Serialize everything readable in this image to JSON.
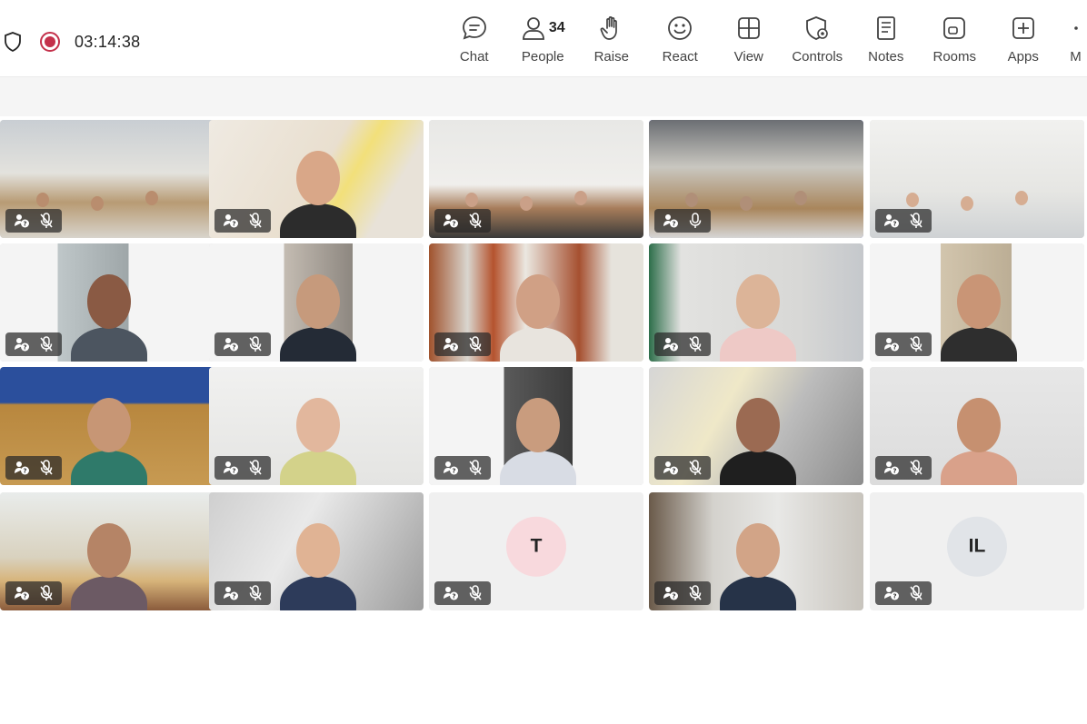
{
  "call": {
    "timer": "03:14:38"
  },
  "toolbar": {
    "items": [
      {
        "label": "Chat",
        "icon": "chat-icon"
      },
      {
        "label": "People",
        "icon": "people-icon",
        "count": "34"
      },
      {
        "label": "Raise",
        "icon": "hand-icon"
      },
      {
        "label": "React",
        "icon": "smiley-icon"
      },
      {
        "label": "View",
        "icon": "grid-icon"
      },
      {
        "label": "Controls",
        "icon": "shield-gear-icon"
      },
      {
        "label": "Notes",
        "icon": "notes-icon"
      },
      {
        "label": "Rooms",
        "icon": "rooms-icon"
      },
      {
        "label": "Apps",
        "icon": "plus-square-icon"
      },
      {
        "label": "M",
        "icon": "more-icon"
      }
    ]
  },
  "participants": [
    {
      "kind": "video",
      "scene": "meeting-room",
      "muted": true
    },
    {
      "kind": "video",
      "scene": "woman-glasses-blurred",
      "muted": true
    },
    {
      "kind": "video",
      "scene": "office-flags",
      "muted": true
    },
    {
      "kind": "video",
      "scene": "conference-hall",
      "muted": false,
      "active": true
    },
    {
      "kind": "video",
      "scene": "group-standing",
      "muted": true
    },
    {
      "kind": "video",
      "scene": "woman-portrait",
      "muted": true
    },
    {
      "kind": "video",
      "scene": "man-glasses-portrait",
      "muted": true
    },
    {
      "kind": "video",
      "scene": "hijab-office",
      "muted": true
    },
    {
      "kind": "video",
      "scene": "man-office-shelves",
      "muted": true
    },
    {
      "kind": "video",
      "scene": "woman-smiling-portrait",
      "muted": true
    },
    {
      "kind": "video",
      "scene": "hijab-blue-board",
      "muted": true
    },
    {
      "kind": "video",
      "scene": "woman-long-hair",
      "muted": true
    },
    {
      "kind": "video",
      "scene": "man-car",
      "muted": true
    },
    {
      "kind": "video",
      "scene": "woman-headset",
      "muted": true
    },
    {
      "kind": "video",
      "scene": "hijab-pink",
      "muted": true
    },
    {
      "kind": "video",
      "scene": "room-two-women",
      "muted": true
    },
    {
      "kind": "video",
      "scene": "hijab-glasses",
      "muted": true
    },
    {
      "kind": "avatar",
      "initials": "T",
      "color": "#f8d9dd",
      "muted": true
    },
    {
      "kind": "video",
      "scene": "hijab-kitchen",
      "muted": true
    },
    {
      "kind": "avatar",
      "initials": "IL",
      "color": "#e1e4e8",
      "muted": true
    }
  ]
}
